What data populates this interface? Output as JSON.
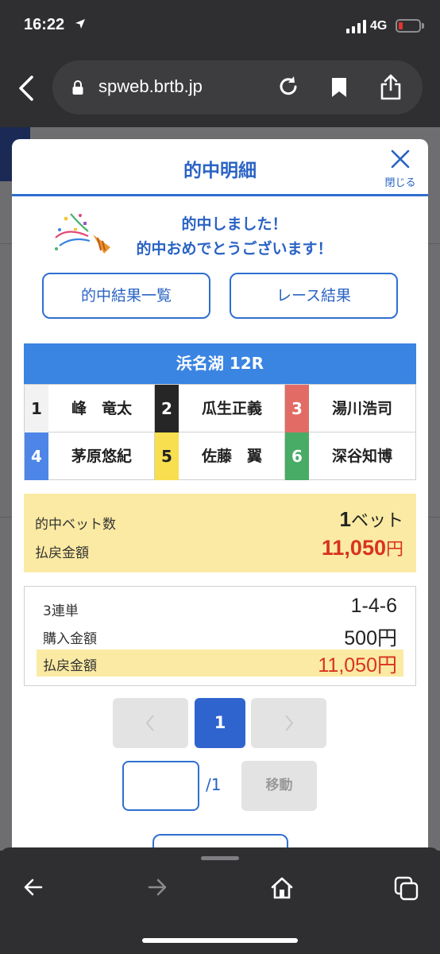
{
  "status": {
    "time": "16:22",
    "network": "4G"
  },
  "browser": {
    "url": "spweb.brtb.jp"
  },
  "modal": {
    "title": "的中明細",
    "close_label": "閉じる",
    "congrats_line1": "的中しました！",
    "congrats_line2": "的中おめでとうございます！",
    "btn_list": "的中結果一覧",
    "btn_race": "レース結果",
    "race_title": "浜名湖 12R",
    "racers": [
      {
        "num": "1",
        "name": "峰　竜太",
        "color": "#f2f2f2",
        "text": "#222222"
      },
      {
        "num": "2",
        "name": "瓜生正義",
        "color": "#262626",
        "text": "#ffffff"
      },
      {
        "num": "3",
        "name": "湯川浩司",
        "color": "#e26b66",
        "text": "#ffffff"
      },
      {
        "num": "4",
        "name": "茅原悠紀",
        "color": "#4d86e6",
        "text": "#ffffff"
      },
      {
        "num": "5",
        "name": "佐藤　翼",
        "color": "#f7df4f",
        "text": "#222222"
      },
      {
        "num": "6",
        "name": "深谷知博",
        "color": "#48ab66",
        "text": "#ffffff"
      }
    ],
    "hits": {
      "bet_label": "的中ベット数",
      "bet_count": "1",
      "bet_unit": "ベット",
      "payout_label": "払戻金額",
      "payout": "11,050",
      "payout_unit": "円"
    },
    "detail": {
      "type_label": "3連単",
      "type_value": "1-4-6",
      "purchase_label": "購入金額",
      "purchase_value": "500円",
      "payout_label": "払戻金額",
      "payout_value": "11,050円"
    },
    "pager": {
      "current": "1",
      "total": "/1",
      "move_label": "移動"
    }
  },
  "colors": {
    "accent": "#2a63c4",
    "header_blue": "#3a84e2",
    "highlight": "#fbeaa3",
    "payout_red": "#d8331f"
  }
}
